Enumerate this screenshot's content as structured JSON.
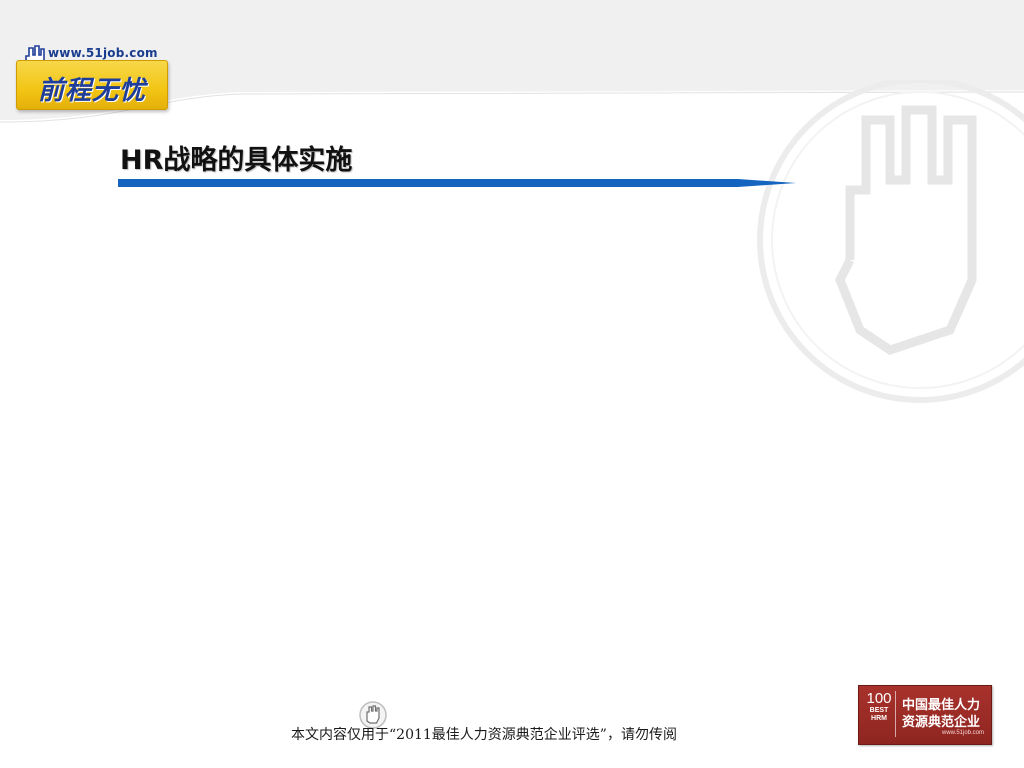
{
  "logo": {
    "url_text": "www.51job.com",
    "brand_text": "前程无忧"
  },
  "slide": {
    "title": "HR战略的具体实施"
  },
  "footer": {
    "notice": "本文内容仅用于“2011最佳人力资源典范企业评选”，请勿传阅"
  },
  "badge": {
    "number": "100",
    "best": "BEST",
    "hrm": "HRM",
    "line1": "中国最佳人力",
    "line2": "资源典范企业",
    "url": "www.51job.com"
  },
  "colors": {
    "title_rule": "#1565c0",
    "logo_yellow": "#f2c514",
    "logo_blue": "#1f3e9a",
    "badge_red": "#a8322c"
  }
}
